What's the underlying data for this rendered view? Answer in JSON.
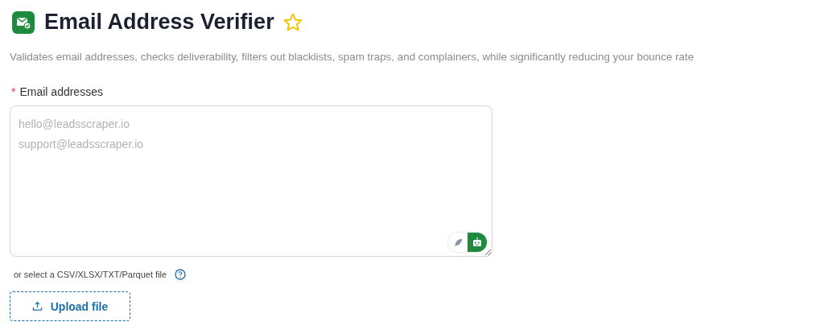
{
  "title": "Email Address Verifier",
  "favorite": false,
  "description": "Validates email addresses, checks deliverability, filters out blacklists, spam traps, and complainers, while significantly reducing your bounce rate",
  "email_field": {
    "label": "Email addresses",
    "required_mark": "*",
    "placeholder": "hello@leadsscraper.io\nsupport@leadsscraper.io",
    "modes": [
      {
        "kind": "feather",
        "selected": false
      },
      {
        "kind": "robot",
        "selected": true
      }
    ]
  },
  "file_hint": "or select a CSV/XLSX/TXT/Parquet file",
  "upload_button": "Upload file"
}
